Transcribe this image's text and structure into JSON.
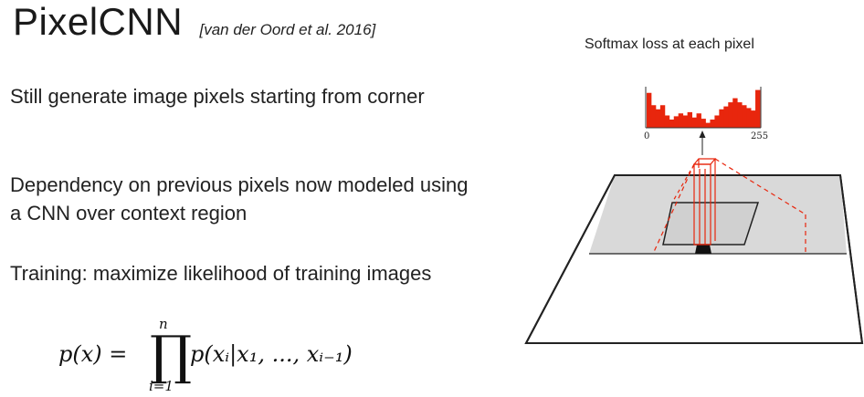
{
  "title": "PixelCNN",
  "citation": "[van der Oord et al. 2016]",
  "bullets": [
    "Still generate image pixels starting from corner",
    "Dependency on previous pixels now modeled using a CNN over context region",
    "Training: maximize likelihood of training images"
  ],
  "formula": {
    "lhs": "p(x) =",
    "product_symbol": "∏",
    "upper_limit": "n",
    "lower_limit": "i=1",
    "rhs": "p(xᵢ|x₁, ..., xᵢ₋₁)"
  },
  "diagram": {
    "caption": "Softmax loss at each pixel",
    "axis_min_label": "0",
    "axis_max_label": "255",
    "histogram_color": "#e8260d",
    "histogram_levels": [
      0.85,
      0.55,
      0.45,
      0.55,
      0.3,
      0.2,
      0.28,
      0.35,
      0.3,
      0.38,
      0.25,
      0.35,
      0.22,
      0.12,
      0.2,
      0.3,
      0.45,
      0.52,
      0.62,
      0.72,
      0.62,
      0.55,
      0.48,
      0.42,
      0.92
    ],
    "context_color": "#d9d9d9",
    "receptive_color": "#e8260d"
  }
}
